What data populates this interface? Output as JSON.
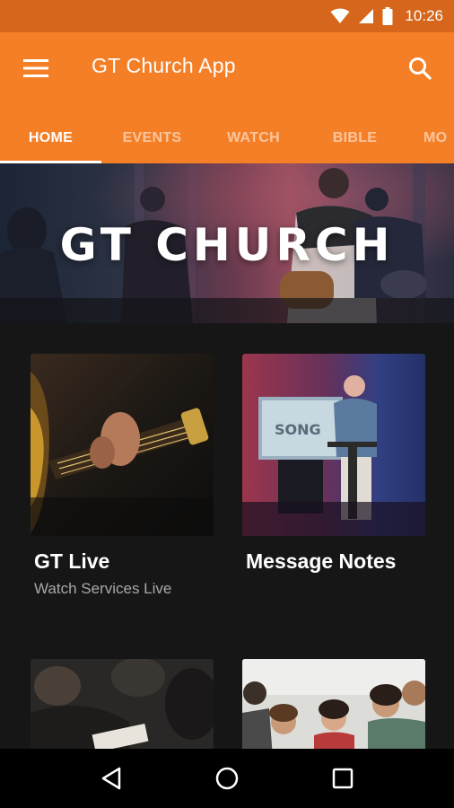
{
  "status_bar": {
    "time": "10:26",
    "icons": [
      "wifi-icon",
      "cellular-icon",
      "battery-icon"
    ]
  },
  "app_bar": {
    "title": "GT Church App",
    "menu_icon": "hamburger-menu-icon",
    "search_icon": "search-icon",
    "color": "#f47f27"
  },
  "tabs": [
    {
      "label": "HOME",
      "active": true
    },
    {
      "label": "EVENTS",
      "active": false
    },
    {
      "label": "WATCH",
      "active": false
    },
    {
      "label": "BIBLE",
      "active": false
    },
    {
      "label": "MO",
      "active": false
    }
  ],
  "hero": {
    "title": "GT CHURCH"
  },
  "cards": [
    {
      "title": "GT Live",
      "subtitle": "Watch Services Live",
      "image": "guitar-photo"
    },
    {
      "title": "Message Notes",
      "subtitle": "",
      "image": "preacher-photo"
    },
    {
      "title": "",
      "subtitle": "",
      "image": "congregation-notes-photo"
    },
    {
      "title": "",
      "subtitle": "",
      "image": "small-group-photo"
    }
  ],
  "nav_bar": {
    "icons": [
      "back-icon",
      "home-icon",
      "recents-icon"
    ]
  }
}
